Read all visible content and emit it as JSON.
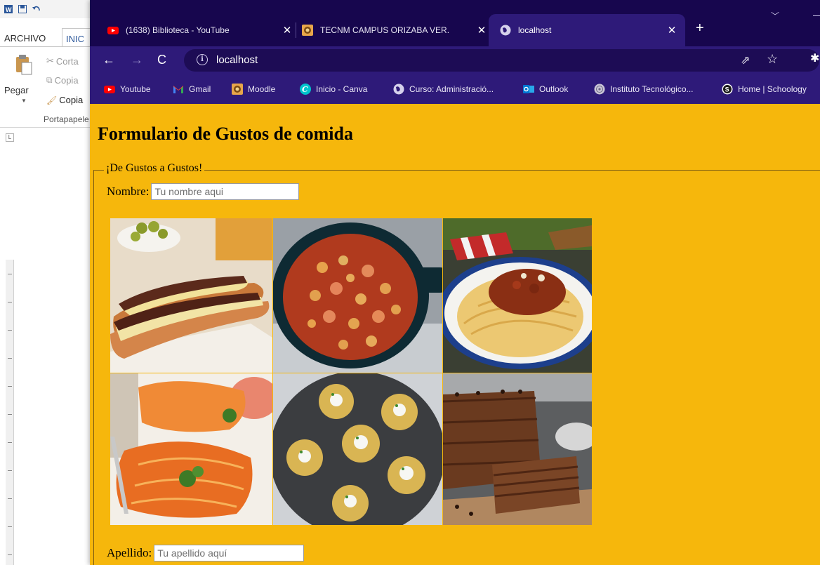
{
  "word": {
    "tab_file": "ARCHIVO",
    "tab_home": "INIC",
    "paste_label": "Pegar",
    "cut_label": "Corta",
    "copy_label": "Copia",
    "format_label": "Copia",
    "group_label": "Portapapele"
  },
  "browser": {
    "tabs": [
      {
        "title": "(1638) Biblioteca - YouTube",
        "icon": "youtube-icon"
      },
      {
        "title": "TECNM CAMPUS ORIZABA VER.",
        "icon": "moodle-icon"
      },
      {
        "title": "localhost",
        "icon": "globe-icon",
        "active": true
      }
    ],
    "address": "localhost",
    "bookmarks": [
      {
        "label": "Youtube",
        "icon": "youtube-icon"
      },
      {
        "label": "Gmail",
        "icon": "gmail-icon"
      },
      {
        "label": "Moodle",
        "icon": "moodle-icon"
      },
      {
        "label": "Inicio - Canva",
        "icon": "canva-icon"
      },
      {
        "label": "Curso: Administració...",
        "icon": "globe-icon"
      },
      {
        "label": "Outlook",
        "icon": "outlook-icon"
      },
      {
        "label": "Instituto Tecnológico...",
        "icon": "seal-icon"
      },
      {
        "label": "Home | Schoology",
        "icon": "schoology-icon"
      }
    ],
    "theme": {
      "tabstrip": "#17064e",
      "toolbar": "#2e1a79",
      "page_bg": "#f6b70c"
    }
  },
  "page": {
    "title": "Formulario de Gustos de comida",
    "legend": "¡De Gustos a Gustos!",
    "nombre_label": "Nombre:",
    "nombre_placeholder": "Tu nombre aqui",
    "apellido_label": "Apellido:",
    "apellido_placeholder": "Tu apellido aquí",
    "gallery": [
      "eclair-photo",
      "octopus-chickpea-stew-photo",
      "spaghetti-bolognese-photo",
      "salmon-fillet-photo",
      "smashed-potatoes-photo",
      "chocolate-biscuit-cake-photo"
    ]
  }
}
